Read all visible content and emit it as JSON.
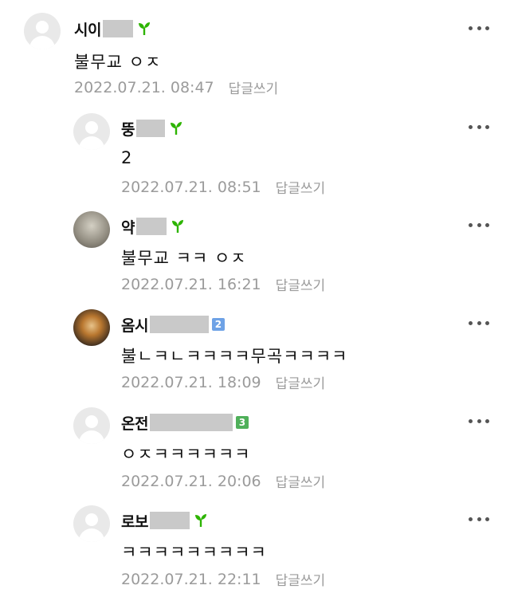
{
  "colors": {
    "sprout": "#2db400",
    "badge2": "#6ea2e6",
    "badge3": "#4fb05a",
    "meta": "#9b9b9b"
  },
  "comments": [
    {
      "nickname": "시이",
      "text": "불무교 ㅇㅈ",
      "date": "2022.07.21. 08:47",
      "reply_label": "답글쓰기",
      "badge": "sprout-icon",
      "avatar": "default"
    },
    {
      "nickname": "뚱",
      "text": "2",
      "date": "2022.07.21. 08:51",
      "reply_label": "답글쓰기",
      "badge": "sprout-icon",
      "avatar": "default"
    },
    {
      "nickname": "약",
      "text": "불무교 ㅋㅋ ㅇㅈ",
      "date": "2022.07.21. 16:21",
      "reply_label": "답글쓰기",
      "badge": "sprout-icon",
      "avatar": "photo"
    },
    {
      "nickname": "옴시",
      "text": "불ㄴㅋㄴㅋㅋㅋㅋ무곡ㅋㅋㅋㅋ",
      "date": "2022.07.21. 18:09",
      "reply_label": "답글쓰기",
      "badge": "2",
      "avatar": "photo"
    },
    {
      "nickname": "온전",
      "text": "ㅇㅈㅋㅋㅋㅋㅋㅋ",
      "date": "2022.07.21. 20:06",
      "reply_label": "답글쓰기",
      "badge": "3",
      "avatar": "default"
    },
    {
      "nickname": "로보",
      "text": "ㅋㅋㅋㅋㅋㅋㅋㅋㅋ",
      "date": "2022.07.21. 22:11",
      "reply_label": "답글쓰기",
      "badge": "sprout-icon",
      "avatar": "default"
    }
  ]
}
